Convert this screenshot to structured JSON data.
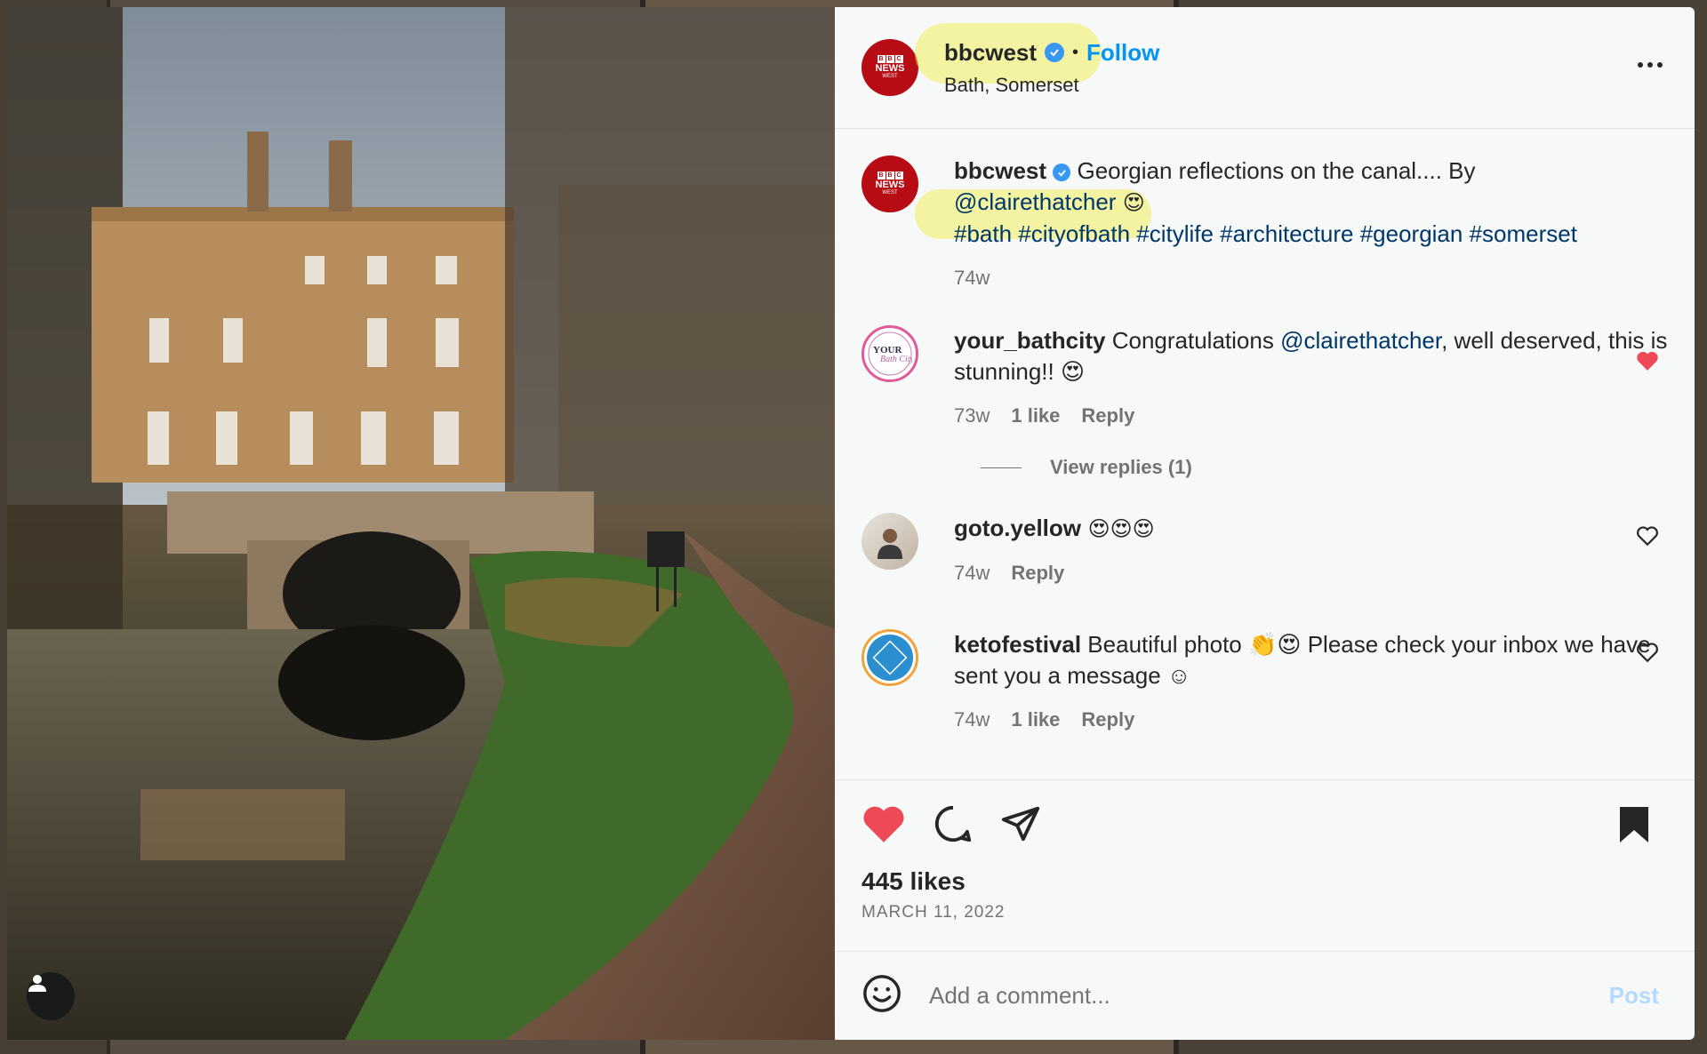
{
  "header": {
    "username": "bbcwest",
    "follow_label": "Follow",
    "location": "Bath, Somerset",
    "avatar": {
      "bbc_letters": [
        "B",
        "B",
        "C"
      ],
      "news": "NEWS",
      "region": "WEST"
    }
  },
  "caption": {
    "username": "bbcwest",
    "text": " Georgian reflections on the canal.... By",
    "mention": "@clairethatcher",
    "emoji": "😍",
    "hashtags": "#bath #cityofbath #citylife #architecture #georgian #somerset",
    "age": "74w"
  },
  "comments": [
    {
      "username": "your_bathcity",
      "text_before": " Congratulations ",
      "mention": "@clairethatcher",
      "text_after": ", well deserved, this is stunning!! 😍",
      "age": "73w",
      "likes": "1 like",
      "reply": "Reply",
      "liked": true
    },
    {
      "username": "goto.yellow",
      "text": " 😍😍😍",
      "age": "74w",
      "reply": "Reply",
      "liked": false
    },
    {
      "username": "ketofestival",
      "text": " Beautiful photo 👏😍 Please check your inbox we have sent you a message ☺",
      "age": "74w",
      "likes": "1 like",
      "reply": "Reply",
      "liked": false
    }
  ],
  "view_replies": "View replies (1)",
  "likes": "445 likes",
  "date": "MARCH 11, 2022",
  "add_comment": {
    "placeholder": "Add a comment...",
    "post_label": "Post"
  },
  "colors": {
    "accent": "#0095f6",
    "like_red": "#ed4956",
    "highlight": "#f0ee5a"
  }
}
